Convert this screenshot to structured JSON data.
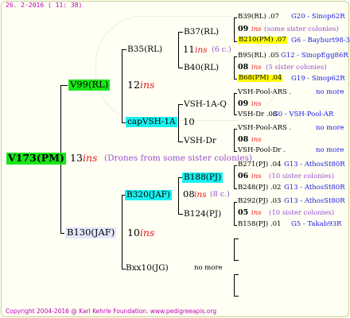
{
  "header": "26.  2-2016 ( 11: 38)",
  "footer": "Copyright 2004-2016 @ Karl Kehrle Foundation.   www.pedigreeapis.org",
  "root": {
    "label": "V173(PM)",
    "count": "13",
    "ins": "ins",
    "note": "(Drones from some sister colonies)"
  },
  "sire": {
    "label": "V99(RL)",
    "count": "12",
    "ins": "ins"
  },
  "dam": {
    "label": "B130(JAF)",
    "count": "10",
    "ins": "ins"
  },
  "sire_sire": {
    "label": "B35(RL)",
    "count": "11",
    "ins": "ins",
    "note": "(6 c.)"
  },
  "sire_dam": {
    "label": "capVSH-1A",
    "count": "10"
  },
  "dam_sire": {
    "label": "B320(JAF)",
    "count": "08",
    "ins": "ins",
    "note": "(8 c.)"
  },
  "dam_dam": {
    "label": "Bxx10(JG)",
    "note": "no more"
  },
  "g3": {
    "b37": {
      "label": "B37(RL)"
    },
    "b40": {
      "label": "B40(RL)"
    },
    "vsh1a": {
      "label": "VSH-1A-Q"
    },
    "vshdr": {
      "label": "VSH-Dr"
    },
    "b188": {
      "label": "B188(PJ)"
    },
    "b124": {
      "label": "B124(PJ)"
    }
  },
  "g4": [
    {
      "label": "B39(RL) .07",
      "info": "G20 - Sinop62R"
    },
    {
      "count": "09",
      "ins": "ins",
      "note": "(some sister colonies)"
    },
    {
      "label": "B210(PM) .07",
      "info": "G6 - Bayburt98-3"
    },
    {
      "label": "B95(RL) .05",
      "info": "G12 - SinopEgg86R"
    },
    {
      "count": "08",
      "ins": "ins",
      "note": "(5 sister colonies)"
    },
    {
      "label": "B68(PM) .04",
      "info": "G19 - Sinop62R"
    },
    {
      "label": "VSH-Pool-ARS .",
      "info": "no more"
    },
    {
      "count": "09",
      "ins": "ins"
    },
    {
      "label": "VSH-Dr .08",
      "info": "G0 - VSH-Pool-AR"
    },
    {
      "label": "VSH-Pool-ARS .",
      "info": "no more"
    },
    {
      "count": "08",
      "ins": "ins"
    },
    {
      "label": "VSH-Pool-Dr .",
      "info": "no more"
    },
    {
      "label": "B271(PJ) .04",
      "info": "G13 - AthosSt80R"
    },
    {
      "count": "06",
      "ins": "ins",
      "note": "(10 sister colonies)"
    },
    {
      "label": "B248(PJ) .02",
      "info": "G13 - AthosSt80R"
    },
    {
      "label": "B292(PJ) .03",
      "info": "G13 - AthosSt80R"
    },
    {
      "count": "05",
      "ins": "ins",
      "note": "(10 sister colonies)"
    },
    {
      "label": "B158(PJ) .01",
      "info": "G5 - Takab93R"
    }
  ]
}
